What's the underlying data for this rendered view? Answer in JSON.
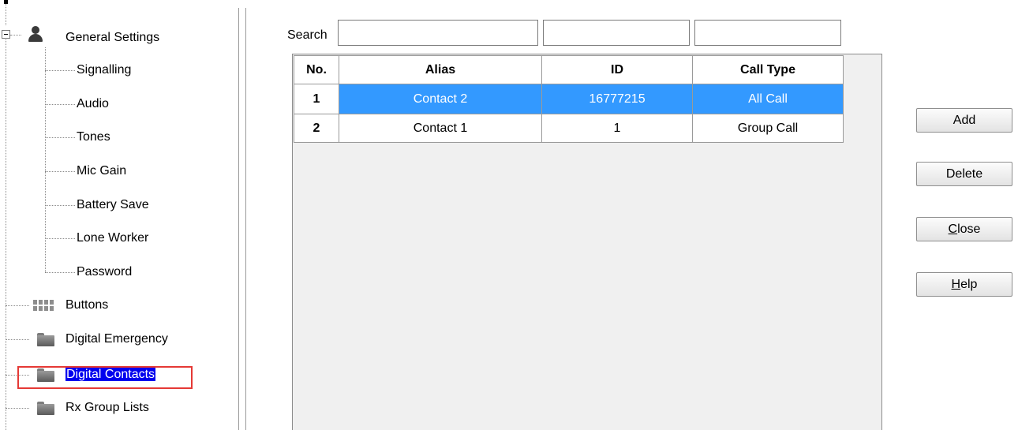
{
  "tree": {
    "general_settings": "General Settings",
    "children": [
      "Signalling",
      "Audio",
      "Tones",
      "Mic Gain",
      "Battery Save",
      "Lone Worker",
      "Password"
    ],
    "buttons": "Buttons",
    "digital_emergency": "Digital Emergency",
    "digital_contacts": "Digital Contacts",
    "rx_group_lists": "Rx Group Lists"
  },
  "search": {
    "label": "Search",
    "values": [
      "",
      "",
      ""
    ]
  },
  "table": {
    "headers": {
      "no": "No.",
      "alias": "Alias",
      "id": "ID",
      "call_type": "Call Type"
    },
    "rows": [
      {
        "no": "1",
        "alias": "Contact 2",
        "id": "16777215",
        "call_type": "All Call"
      },
      {
        "no": "2",
        "alias": "Contact 1",
        "id": "1",
        "call_type": "Group Call"
      }
    ]
  },
  "buttons": {
    "add": "Add",
    "delete": "Delete",
    "close_mn": "C",
    "close_rest": "lose",
    "help_mn": "H",
    "help_rest": "elp"
  },
  "colors": {
    "row_selected": "#3399ff",
    "tree_selected": "#0000ee",
    "highlight_box": "#e53935"
  }
}
